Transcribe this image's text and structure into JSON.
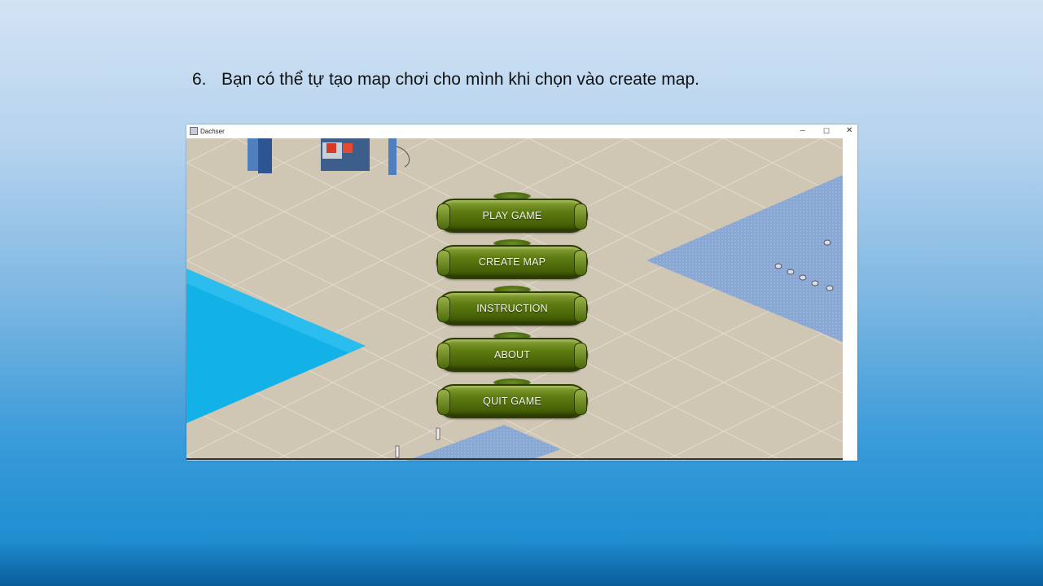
{
  "slide": {
    "item_number": "6.",
    "item_text": "Bạn có thể tự tạo map chơi cho mình khi chọn vào create map."
  },
  "window": {
    "title": "Dachser",
    "controls": {
      "minimize": "–",
      "maximize": "☐",
      "close": "✕"
    }
  },
  "menu": {
    "buttons": [
      {
        "label": "PLAY GAME"
      },
      {
        "label": "CREATE MAP"
      },
      {
        "label": "INSTRUCTION"
      },
      {
        "label": "ABOUT"
      },
      {
        "label": "QUIT GAME"
      }
    ]
  },
  "colors": {
    "button_green": "#4b6608",
    "floor_beige": "#cfc6b4",
    "water_blue": "#12b1e8",
    "tile_blue": "#89a7d3"
  }
}
